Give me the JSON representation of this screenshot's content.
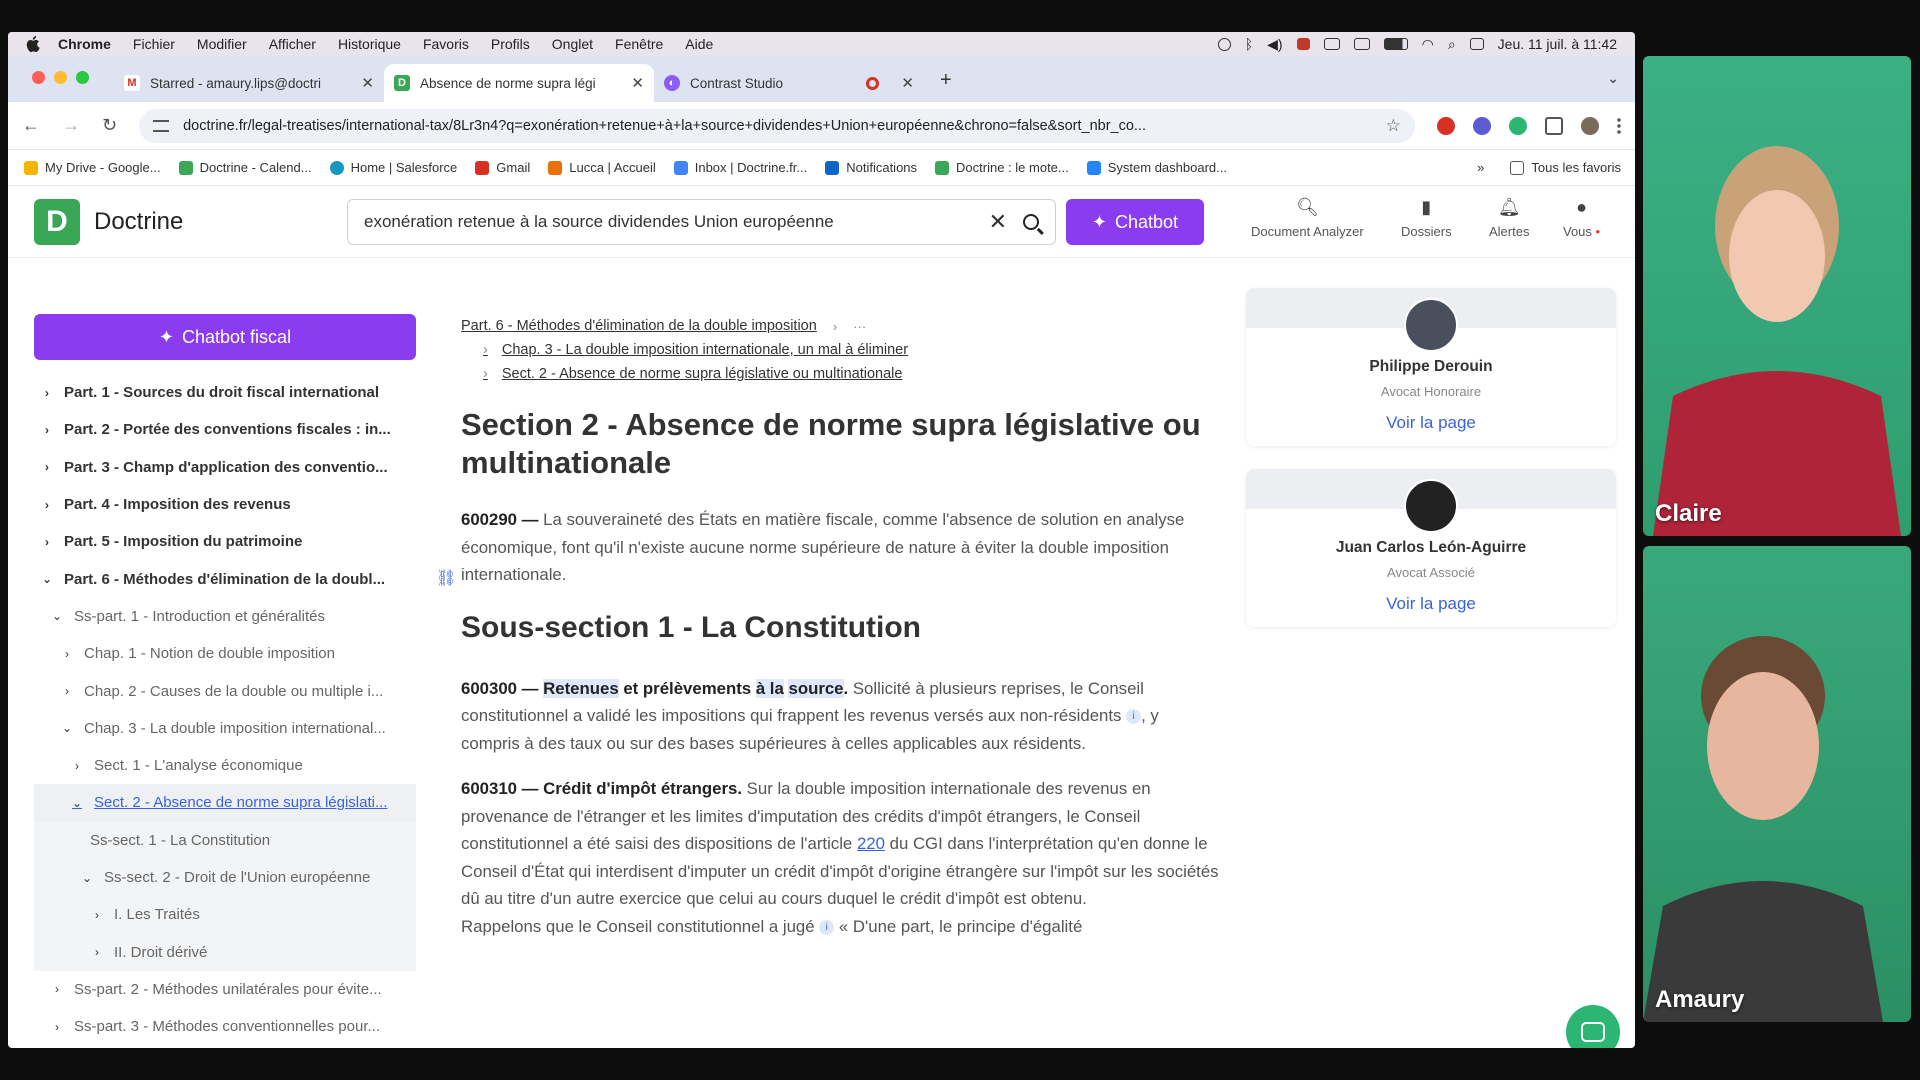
{
  "menubar": {
    "app": "Chrome",
    "items": [
      "Fichier",
      "Modifier",
      "Afficher",
      "Historique",
      "Favoris",
      "Profils",
      "Onglet",
      "Fenêtre",
      "Aide"
    ],
    "clock": "Jeu. 11 juil. à 11:42"
  },
  "tabs": [
    {
      "title": "Starred - amaury.lips@doctri",
      "favicon": "gmail-icon",
      "color": "#d93025"
    },
    {
      "title": "Absence de norme supra légi",
      "favicon": "doctrine-icon",
      "color": "#3aa757"
    },
    {
      "title": "Contrast Studio",
      "favicon": "contrast-icon",
      "color": "#8b5cf6"
    }
  ],
  "address": {
    "url": "doctrine.fr/legal-treatises/international-tax/8Lr3n4?q=exonération+retenue+à+la+source+dividendes+Union+européenne&chrono=false&sort_nbr_co..."
  },
  "bookmarks": [
    {
      "label": "My Drive - Google...",
      "color": "#f4b400"
    },
    {
      "label": "Doctrine - Calend...",
      "color": "#3aa757"
    },
    {
      "label": "Home | Salesforce",
      "color": "#1798c1"
    },
    {
      "label": "Gmail",
      "color": "#d93025"
    },
    {
      "label": "Lucca | Accueil",
      "color": "#e8710a"
    },
    {
      "label": "Inbox | Doctrine.fr...",
      "color": "#4285f4"
    },
    {
      "label": "Notifications",
      "color": "#0a66c2"
    },
    {
      "label": "Doctrine : le mote...",
      "color": "#3aa757"
    },
    {
      "label": "System dashboard...",
      "color": "#2684ff"
    }
  ],
  "bookmarks_more": "»",
  "bookmarks_all": "Tous les favoris",
  "header": {
    "brand": "Doctrine",
    "logo_letter": "D",
    "search_query": "exonération retenue à la source dividendes Union européenne",
    "chatbot_label": "Chatbot",
    "nav": [
      {
        "label": "Document Analyzer",
        "icon": "document-analyzer-icon"
      },
      {
        "label": "Dossiers",
        "icon": "bookmark-icon"
      },
      {
        "label": "Alertes",
        "icon": "bell-icon"
      },
      {
        "label": "Vous",
        "icon": "user-icon"
      }
    ]
  },
  "sidebar": {
    "chatbot_label": "Chatbot fiscal",
    "items": [
      {
        "label": "Part. 1 - Sources du droit fiscal international"
      },
      {
        "label": "Part. 2 - Portée des conventions fiscales : in..."
      },
      {
        "label": "Part. 3 - Champ d'application des conventio..."
      },
      {
        "label": "Part. 4 - Imposition des revenus"
      },
      {
        "label": "Part. 5 - Imposition du patrimoine"
      },
      {
        "label": "Part. 6 - Méthodes d'élimination de la doubl..."
      },
      {
        "label": "Ss-part. 1 - Introduction et généralités"
      },
      {
        "label": "Chap. 1 - Notion de double imposition"
      },
      {
        "label": "Chap. 2 - Causes de la double ou multiple i..."
      },
      {
        "label": "Chap. 3 - La double imposition international..."
      },
      {
        "label": "Sect. 1 - L'analyse économique"
      },
      {
        "label": "Sect. 2 - Absence de norme supra législati..."
      },
      {
        "label": "Ss-sect. 1 - La Constitution"
      },
      {
        "label": "Ss-sect. 2 - Droit de l'Union européenne"
      },
      {
        "label": "I. Les Traités"
      },
      {
        "label": "II. Droit dérivé"
      },
      {
        "label": "Ss-part. 2 - Méthodes unilatérales pour évite..."
      },
      {
        "label": "Ss-part. 3 - Méthodes conventionnelles pour..."
      }
    ]
  },
  "breadcrumb": {
    "part": "Part. 6 - Méthodes d'élimination de la double imposition",
    "ellipsis": "···",
    "chap": "Chap. 3 - La double imposition internationale, un mal à éliminer",
    "sect": "Sect. 2 - Absence de norme supra législative ou multinationale"
  },
  "content": {
    "title": "Section 2 - Absence de norme supra législative ou multinationale",
    "p1_num": "600290 —",
    "p1_text": "La souveraineté des États en matière fiscale, comme l'absence de solution en analyse économique, font qu'il n'existe aucune norme supérieure de nature à éviter la double imposition internationale.",
    "subtitle": "Sous-section 1 - La Constitution",
    "p2_num": "600300 —",
    "p2_h1": "Retenues",
    "p2_h2": "et prélèvements",
    "p2_h3": "à la",
    "p2_h4": "source",
    "p2_h5": ".",
    "p2_a": "Sollicité à plusieurs reprises, le Conseil constitutionnel a validé les impositions qui frappent les revenus versés aux non-résidents",
    "p2_b": ", y compris à des taux ou sur des bases supérieures à celles applicables aux résidents.",
    "p3_num": "600310 —",
    "p3_head": "Crédit d'impôt étrangers.",
    "p3_a": "Sur la double imposition internationale des revenus en provenance de l'étranger et les limites d'imputation des crédits d'impôt étrangers, le Conseil constitutionnel a été saisi des dispositions de l'article",
    "p3_link": "220",
    "p3_b": "du CGI dans l'interprétation qu'en donne le Conseil d'État qui interdisent d'imputer un crédit d'impôt d'origine étrangère sur l'impôt sur les sociétés dû au titre d'un autre exercice que celui au cours duquel le crédit d'impôt est obtenu.",
    "p4_a": "Rappelons que le Conseil constitutionnel a jugé",
    "p4_b": "« D'une part, le principe d'égalité"
  },
  "authors": [
    {
      "name": "Philippe Derouin",
      "role": "Avocat Honoraire",
      "link": "Voir la page"
    },
    {
      "name": "Juan Carlos León-Aguirre",
      "role": "Avocat Associé",
      "link": "Voir la page"
    }
  ],
  "participants": [
    {
      "name": "Claire"
    },
    {
      "name": "Amaury"
    }
  ]
}
